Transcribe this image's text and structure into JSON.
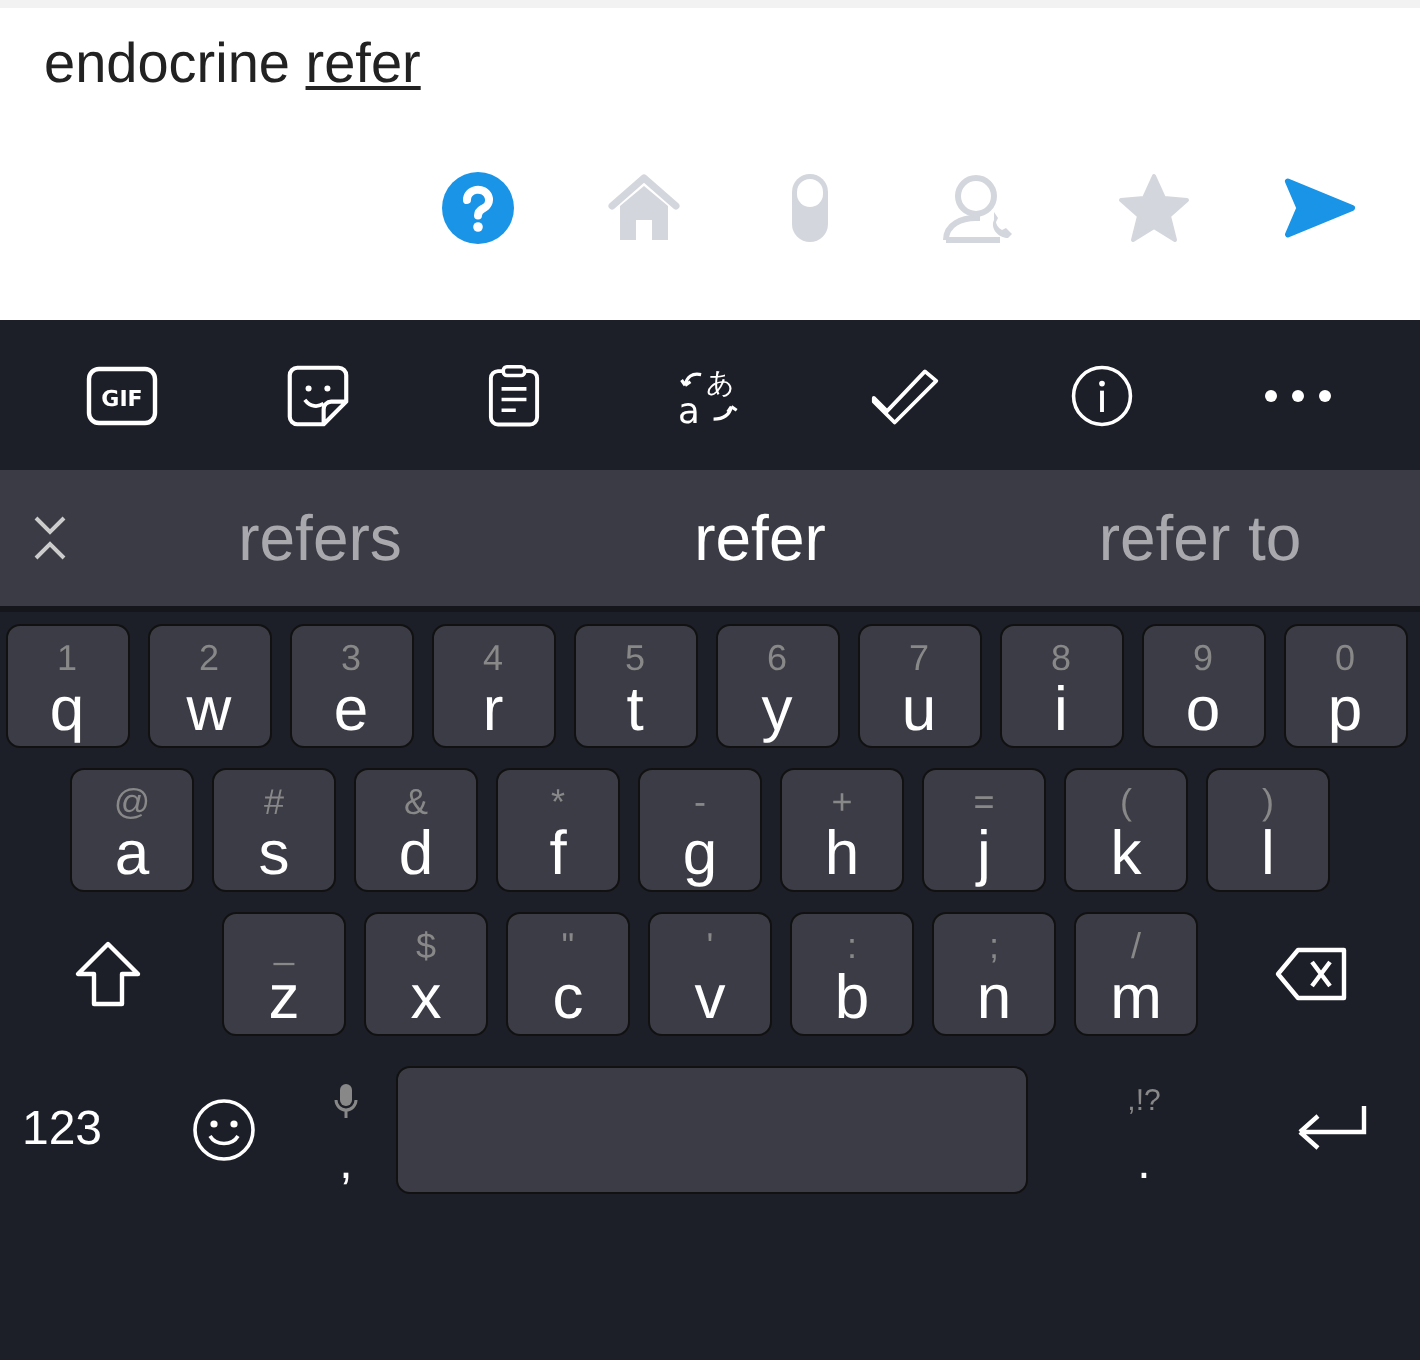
{
  "input": {
    "text": "endocrine",
    "composing": "refer"
  },
  "actions": [
    {
      "kind": "help",
      "active": true
    },
    {
      "kind": "home",
      "active": false
    },
    {
      "kind": "pill",
      "active": false
    },
    {
      "kind": "contact",
      "active": false
    },
    {
      "kind": "star",
      "active": false
    },
    {
      "kind": "send",
      "active": true
    }
  ],
  "toolbar": [
    {
      "kind": "gif",
      "label": "GIF"
    },
    {
      "kind": "sticker"
    },
    {
      "kind": "clipboard"
    },
    {
      "kind": "translate",
      "glyphs": [
        "a",
        "あ"
      ]
    },
    {
      "kind": "check"
    },
    {
      "kind": "info"
    },
    {
      "kind": "more"
    }
  ],
  "suggestions": [
    {
      "text": "refers",
      "selected": false
    },
    {
      "text": "refer",
      "selected": true
    },
    {
      "text": "refer to",
      "selected": false
    }
  ],
  "rows": [
    [
      {
        "main": "q",
        "hint": "1"
      },
      {
        "main": "w",
        "hint": "2"
      },
      {
        "main": "e",
        "hint": "3"
      },
      {
        "main": "r",
        "hint": "4"
      },
      {
        "main": "t",
        "hint": "5"
      },
      {
        "main": "y",
        "hint": "6"
      },
      {
        "main": "u",
        "hint": "7"
      },
      {
        "main": "i",
        "hint": "8"
      },
      {
        "main": "o",
        "hint": "9"
      },
      {
        "main": "p",
        "hint": "0"
      }
    ],
    [
      {
        "main": "a",
        "hint": "@"
      },
      {
        "main": "s",
        "hint": "#"
      },
      {
        "main": "d",
        "hint": "&"
      },
      {
        "main": "f",
        "hint": "*"
      },
      {
        "main": "g",
        "hint": "-"
      },
      {
        "main": "h",
        "hint": "+"
      },
      {
        "main": "j",
        "hint": "="
      },
      {
        "main": "k",
        "hint": "("
      },
      {
        "main": "l",
        "hint": ")"
      }
    ],
    [
      {
        "main": "z",
        "hint": "_"
      },
      {
        "main": "x",
        "hint": "$"
      },
      {
        "main": "c",
        "hint": "\""
      },
      {
        "main": "v",
        "hint": "'"
      },
      {
        "main": "b",
        "hint": ":"
      },
      {
        "main": "n",
        "hint": ";"
      },
      {
        "main": "m",
        "hint": "/"
      }
    ]
  ],
  "bottom": {
    "symbols": "123",
    "comma": ",",
    "period": ".",
    "period_hint": ",!?"
  }
}
